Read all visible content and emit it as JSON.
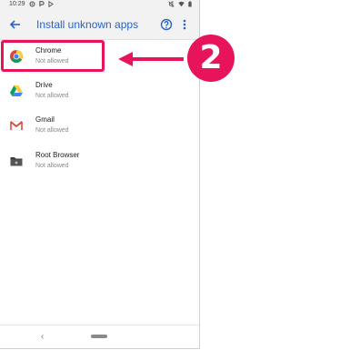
{
  "status_bar": {
    "time": "10:29",
    "left_icons": [
      "settings-icon",
      "parking-icon",
      "play-store-icon"
    ],
    "right_icons": [
      "mute-icon",
      "wifi-icon",
      "battery-icon"
    ]
  },
  "app_bar": {
    "title": "Install unknown apps",
    "back_icon": "back-arrow-icon",
    "help_icon": "help-icon",
    "more_icon": "more-vert-icon",
    "accent_color": "#2a63c8"
  },
  "apps": [
    {
      "name": "Chrome",
      "status": "Not allowed",
      "icon": "chrome-icon"
    },
    {
      "name": "Drive",
      "status": "Not allowed",
      "icon": "drive-icon"
    },
    {
      "name": "Gmail",
      "status": "Not allowed",
      "icon": "gmail-icon"
    },
    {
      "name": "Root Browser",
      "status": "Not allowed",
      "icon": "root-browser-icon"
    }
  ],
  "nav_bar": {
    "back_glyph": "‹",
    "home_icon": "home-pill-icon"
  },
  "annotation": {
    "step_number": "2",
    "color": "#e8145b",
    "highlighted_item": "Chrome"
  }
}
